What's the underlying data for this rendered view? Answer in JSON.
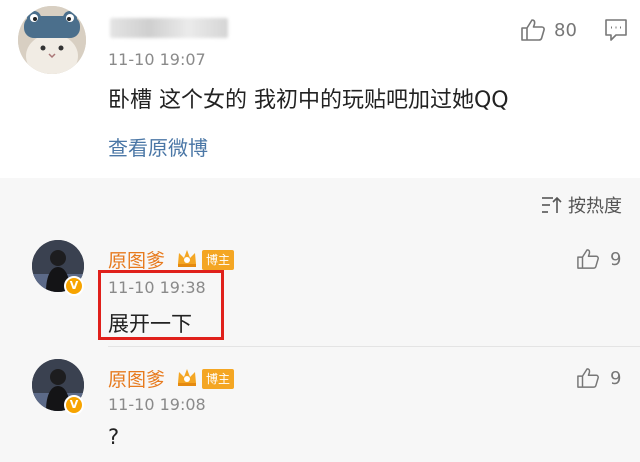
{
  "main_comment": {
    "timestamp": "11-10 19:07",
    "text": "卧槽 这个女的 我初中的玩贴吧加过她QQ",
    "view_original_label": "查看原微博",
    "like_count": "80"
  },
  "sort": {
    "label": "按热度"
  },
  "replies": [
    {
      "name": "原图爹",
      "badge": "博主",
      "verified": "V",
      "timestamp": "11-10 19:38",
      "text": "展开一下",
      "like_count": "9"
    },
    {
      "name": "原图爹",
      "badge": "博主",
      "verified": "V",
      "timestamp": "11-10 19:08",
      "text": "?",
      "like_count": "9"
    }
  ],
  "colors": {
    "link": "#4b77a6",
    "username": "#e77a1d",
    "badge": "#f4a623",
    "highlight": "#e0201b"
  }
}
